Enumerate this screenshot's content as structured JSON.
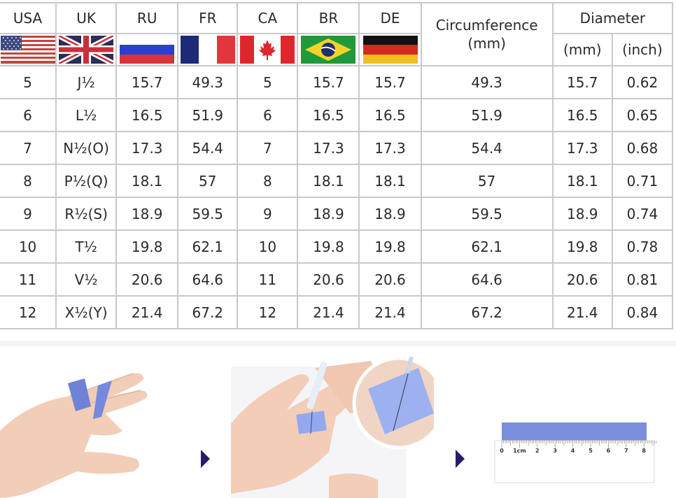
{
  "table": {
    "columns": [
      {
        "key": "usa",
        "label": "USA",
        "flag": "usa-flag-icon"
      },
      {
        "key": "uk",
        "label": "UK",
        "flag": "uk-flag-icon"
      },
      {
        "key": "ru",
        "label": "RU",
        "flag": "russia-flag-icon"
      },
      {
        "key": "fr",
        "label": "FR",
        "flag": "france-flag-icon"
      },
      {
        "key": "ca",
        "label": "CA",
        "flag": "canada-flag-icon"
      },
      {
        "key": "br",
        "label": "BR",
        "flag": "brazil-flag-icon"
      },
      {
        "key": "de",
        "label": "DE",
        "flag": "germany-flag-icon"
      }
    ],
    "circumference_header": {
      "line1": "Circumference",
      "line2": "(mm)"
    },
    "diameter_header": {
      "label": "Diameter",
      "mm": "(mm)",
      "inch": "(inch)"
    },
    "rows": [
      {
        "usa": "5",
        "uk": "J½",
        "ru": "15.7",
        "fr": "49.3",
        "ca": "5",
        "br": "15.7",
        "de": "15.7",
        "circ": "49.3",
        "dia_mm": "15.7",
        "dia_in": "0.62"
      },
      {
        "usa": "6",
        "uk": "L½",
        "ru": "16.5",
        "fr": "51.9",
        "ca": "6",
        "br": "16.5",
        "de": "16.5",
        "circ": "51.9",
        "dia_mm": "16.5",
        "dia_in": "0.65"
      },
      {
        "usa": "7",
        "uk": "N½(O)",
        "ru": "17.3",
        "fr": "54.4",
        "ca": "7",
        "br": "17.3",
        "de": "17.3",
        "circ": "54.4",
        "dia_mm": "17.3",
        "dia_in": "0.68"
      },
      {
        "usa": "8",
        "uk": "P½(Q)",
        "ru": "18.1",
        "fr": "57",
        "ca": "8",
        "br": "18.1",
        "de": "18.1",
        "circ": "57",
        "dia_mm": "18.1",
        "dia_in": "0.71"
      },
      {
        "usa": "9",
        "uk": "R½(S)",
        "ru": "18.9",
        "fr": "59.5",
        "ca": "9",
        "br": "18.9",
        "de": "18.9",
        "circ": "59.5",
        "dia_mm": "18.9",
        "dia_in": "0.74"
      },
      {
        "usa": "10",
        "uk": "T½",
        "ru": "19.8",
        "fr": "62.1",
        "ca": "10",
        "br": "19.8",
        "de": "19.8",
        "circ": "62.1",
        "dia_mm": "19.8",
        "dia_in": "0.78"
      },
      {
        "usa": "11",
        "uk": "V½",
        "ru": "20.6",
        "fr": "64.6",
        "ca": "11",
        "br": "20.6",
        "de": "20.6",
        "circ": "64.6",
        "dia_mm": "20.6",
        "dia_in": "0.81"
      },
      {
        "usa": "12",
        "uk": "X½(Y)",
        "ru": "21.4",
        "fr": "67.2",
        "ca": "12",
        "br": "21.4",
        "de": "21.4",
        "circ": "67.2",
        "dia_mm": "21.4",
        "dia_in": "0.84"
      }
    ]
  },
  "instructions": {
    "steps": [
      {
        "name": "wrap-paper-strip",
        "image": "hand-with-paper-strip-illustration"
      },
      {
        "name": "mark-overlap",
        "image": "hand-marking-strip-with-pen-illustration"
      },
      {
        "name": "measure-on-ruler",
        "image": "strip-on-ruler-illustration"
      }
    ],
    "arrow_icon": "step-arrow-icon",
    "ruler_labels": [
      "0",
      "1cm",
      "2",
      "3",
      "4",
      "5",
      "6",
      "7",
      "8"
    ],
    "colors": {
      "strip": "#7b8fdc",
      "arrow": "#2a1c6a",
      "grid": "#c9c9c9"
    }
  }
}
